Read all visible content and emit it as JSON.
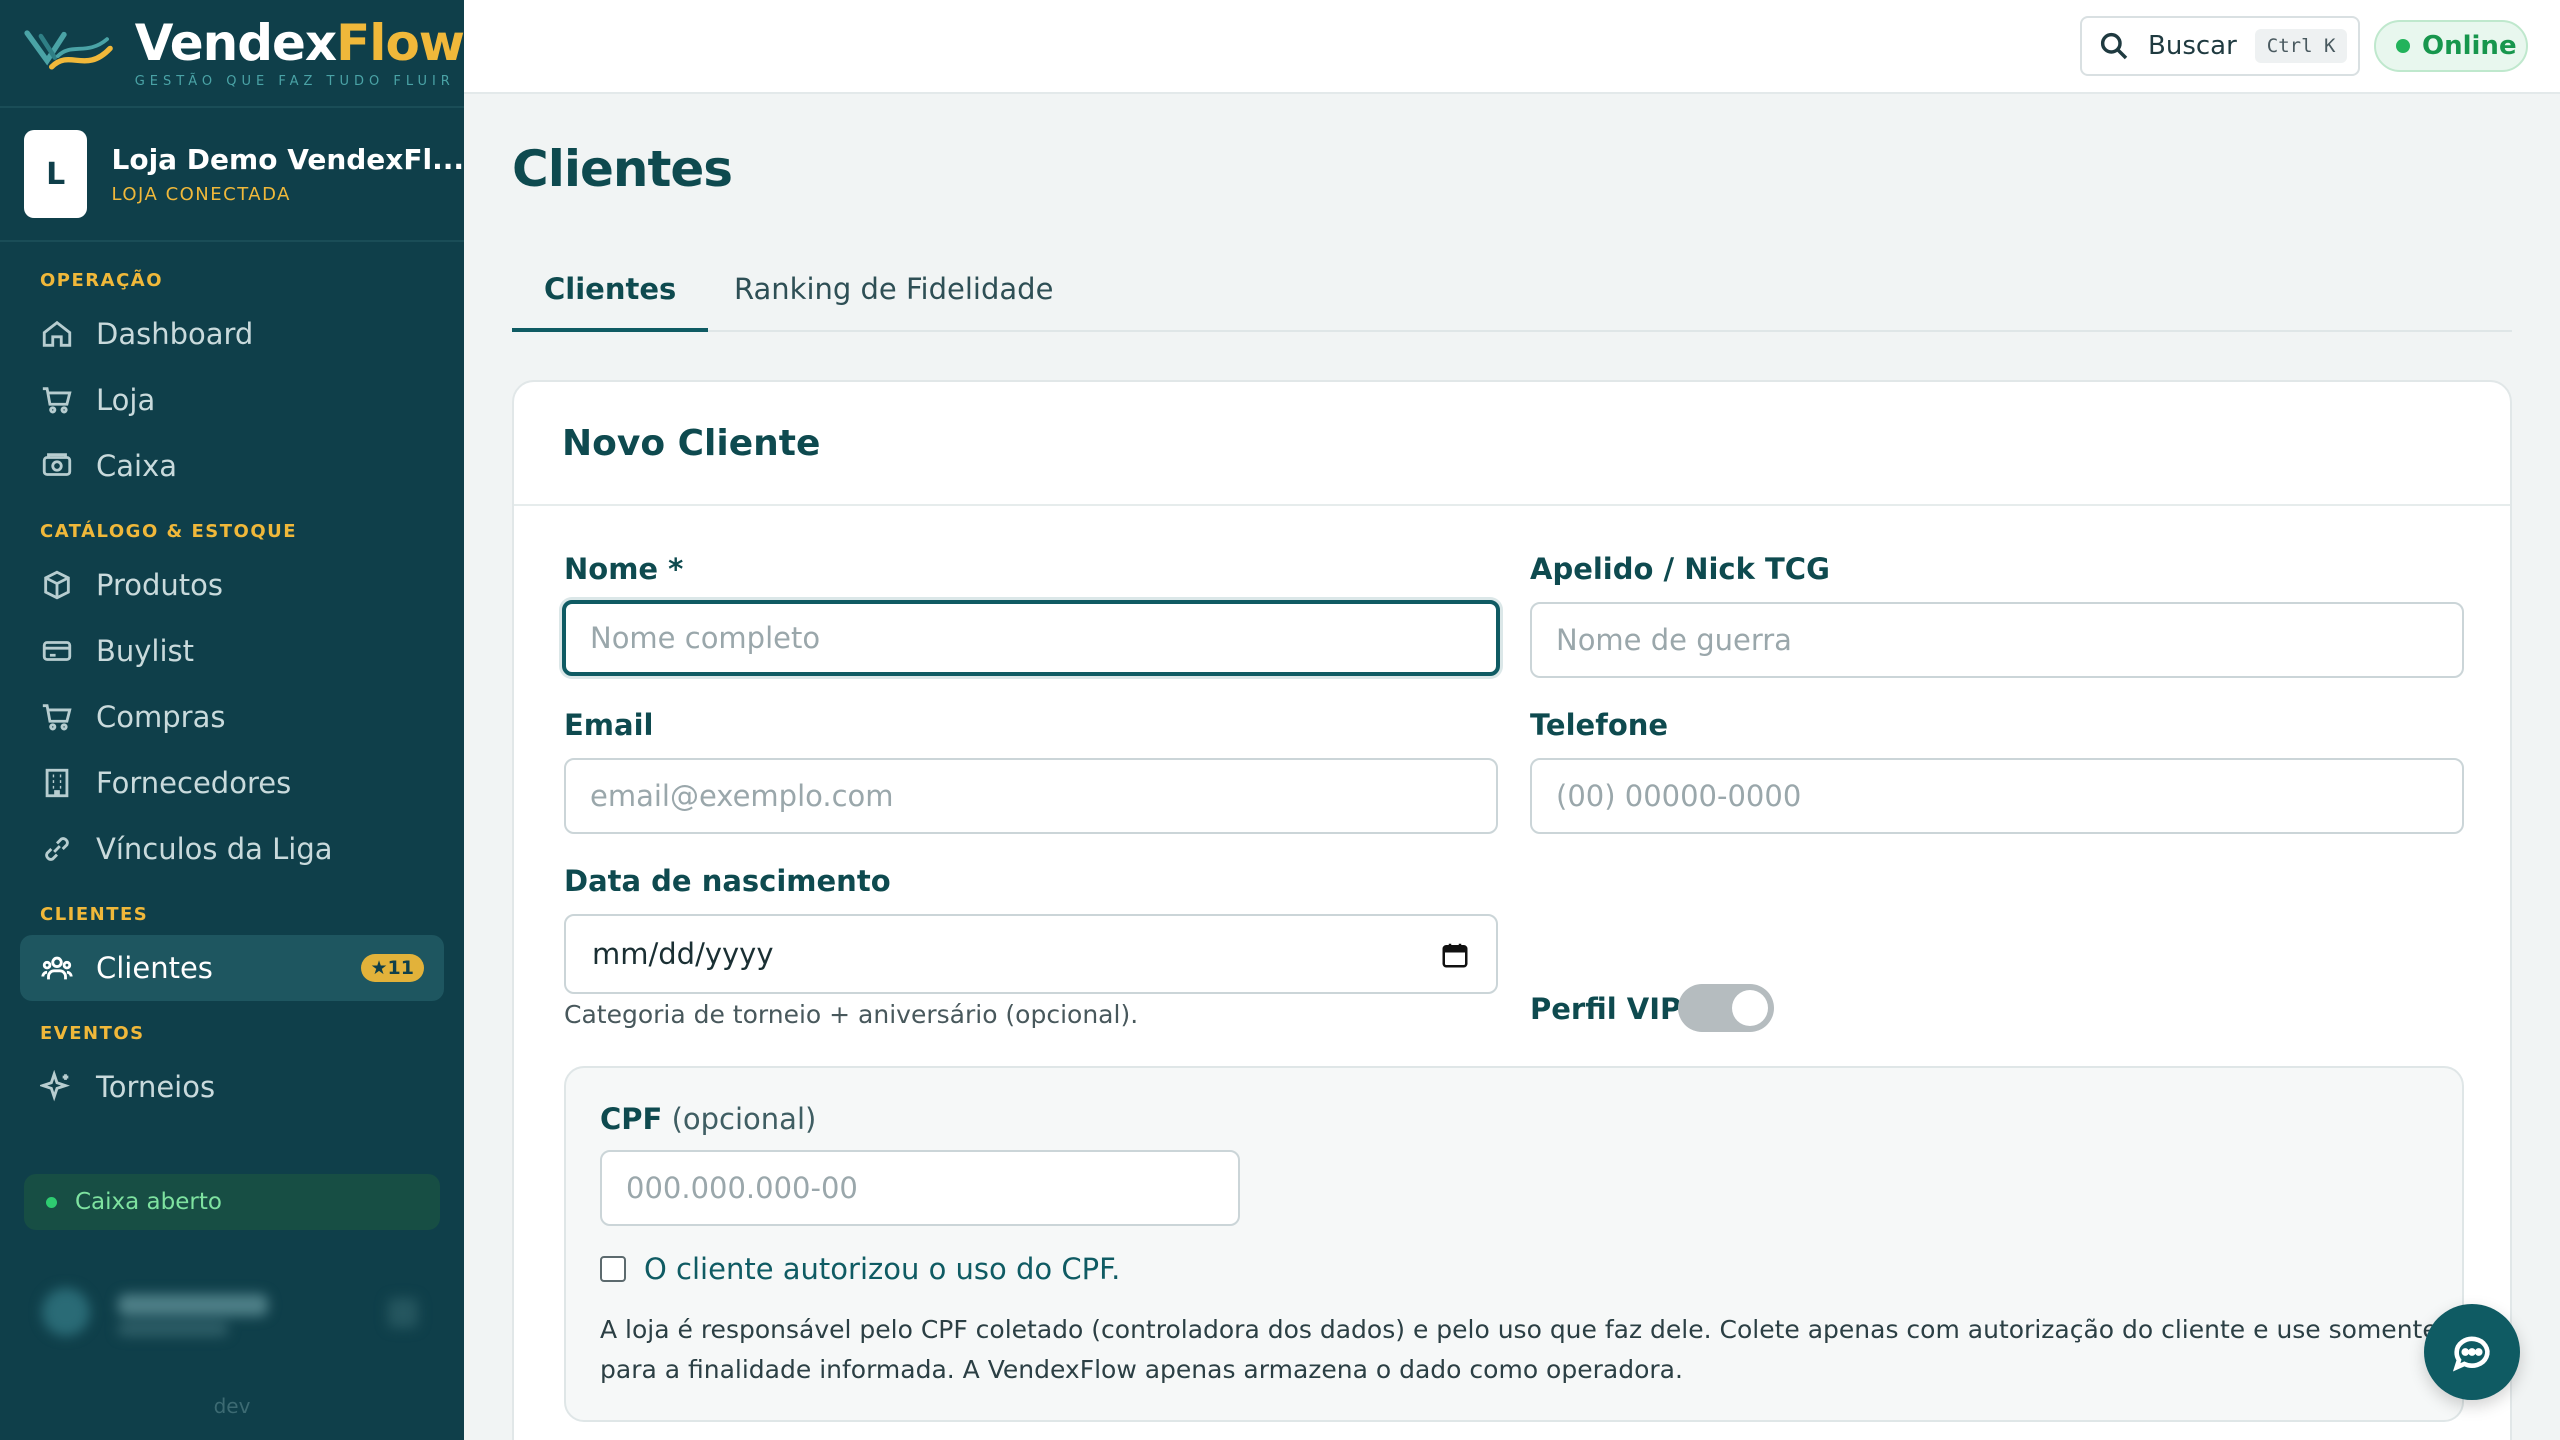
{
  "brand": {
    "name_part1": "Vendex",
    "name_part2": "Flow",
    "tagline": "GESTÃO QUE FAZ TUDO FLUIR"
  },
  "store": {
    "avatar_letter": "L",
    "name": "Loja Demo VendexFl...",
    "status": "LOJA CONECTADA"
  },
  "sidebar": {
    "sections": [
      {
        "title": "OPERAÇÃO"
      },
      {
        "title": "CATÁLOGO & ESTOQUE"
      },
      {
        "title": "CLIENTES"
      },
      {
        "title": "EVENTOS"
      }
    ],
    "items": [
      {
        "label": "Dashboard",
        "icon": "home-icon"
      },
      {
        "label": "Loja",
        "icon": "cart-icon"
      },
      {
        "label": "Caixa",
        "icon": "cash-register-icon"
      },
      {
        "label": "Produtos",
        "icon": "box-icon"
      },
      {
        "label": "Buylist",
        "icon": "card-icon"
      },
      {
        "label": "Compras",
        "icon": "cart-icon"
      },
      {
        "label": "Fornecedores",
        "icon": "building-icon"
      },
      {
        "label": "Vínculos da Liga",
        "icon": "link-icon"
      },
      {
        "label": "Clientes",
        "icon": "users-icon",
        "badge": "★11",
        "active": true
      },
      {
        "label": "Torneios",
        "icon": "sparkles-icon"
      }
    ],
    "caixa_status": "Caixa aberto",
    "env": "dev"
  },
  "topbar": {
    "search_label": "Buscar",
    "search_shortcut": "Ctrl K",
    "status": "Online"
  },
  "page": {
    "title": "Clientes",
    "tabs": [
      {
        "label": "Clientes",
        "active": true
      },
      {
        "label": "Ranking de Fidelidade",
        "active": false
      }
    ]
  },
  "form": {
    "title": "Novo Cliente",
    "nome_label": "Nome *",
    "nome_placeholder": "Nome completo",
    "apelido_label": "Apelido / Nick TCG",
    "apelido_placeholder": "Nome de guerra",
    "email_label": "Email",
    "email_placeholder": "email@exemplo.com",
    "telefone_label": "Telefone",
    "telefone_placeholder": "(00) 00000-0000",
    "nascimento_label": "Data de nascimento",
    "nascimento_value": "mm/dd/yyyy",
    "nascimento_hint": "Categoria de torneio + aniversário (opcional).",
    "vip_label": "Perfil VIP",
    "vip_enabled": false,
    "cpf_label": "CPF",
    "cpf_optional": "(opcional)",
    "cpf_placeholder": "000.000.000-00",
    "cpf_consent_label": "O cliente autorizou o uso do CPF.",
    "cpf_consent_checked": false,
    "cpf_note": "A loja é responsável pelo CPF coletado (controladora dos dados) e pelo uso que faz dele. Colete apenas com autorização do cliente e use somente para a finalidade informada. A VendexFlow apenas armazena o dado como operadora."
  },
  "colors": {
    "sidebar_bg": "#0f3f4a",
    "accent_gold": "#f0b83a",
    "primary_teal": "#0f5b63",
    "online_green": "#22b35b"
  }
}
